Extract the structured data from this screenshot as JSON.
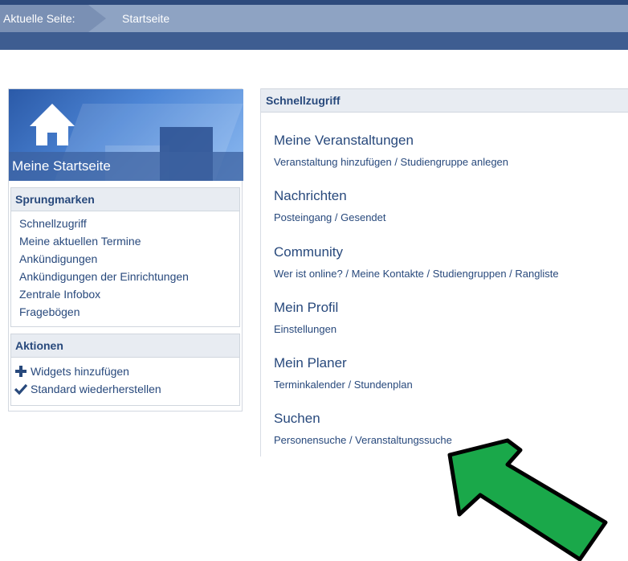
{
  "breadcrumb": {
    "label": "Aktuelle Seite:",
    "current": "Startseite"
  },
  "sidebar": {
    "hero_title": "Meine Startseite",
    "sprungmarken": {
      "heading": "Sprungmarken",
      "items": [
        "Schnellzugriff",
        "Meine aktuellen Termine",
        "Ankündigungen",
        "Ankündigungen der Einrichtungen",
        "Zentrale Infobox",
        "Fragebögen"
      ]
    },
    "aktionen": {
      "heading": "Aktionen",
      "items": [
        {
          "label": "Widgets hinzufügen",
          "icon": "plus-icon"
        },
        {
          "label": "Standard wiederherstellen",
          "icon": "checkmark-icon"
        }
      ]
    }
  },
  "main": {
    "heading": "Schnellzugriff",
    "sections": [
      {
        "title": "Meine Veranstaltungen",
        "links": "Veranstaltung hinzufügen / Studiengruppe anlegen"
      },
      {
        "title": "Nachrichten",
        "links": "Posteingang / Gesendet"
      },
      {
        "title": "Community",
        "links": "Wer ist online? / Meine Kontakte / Studiengruppen / Rangliste"
      },
      {
        "title": "Mein Profil",
        "links": "Einstellungen"
      },
      {
        "title": "Mein Planer",
        "links": "Terminkalender / Stundenplan"
      },
      {
        "title": "Suchen",
        "links": "Personensuche / Veranstaltungssuche"
      }
    ]
  },
  "colors": {
    "header": "#3e5d91",
    "breadcrumb": "#7a90b4",
    "link_text": "#28497c",
    "arrow_fill": "#1aa84a"
  }
}
